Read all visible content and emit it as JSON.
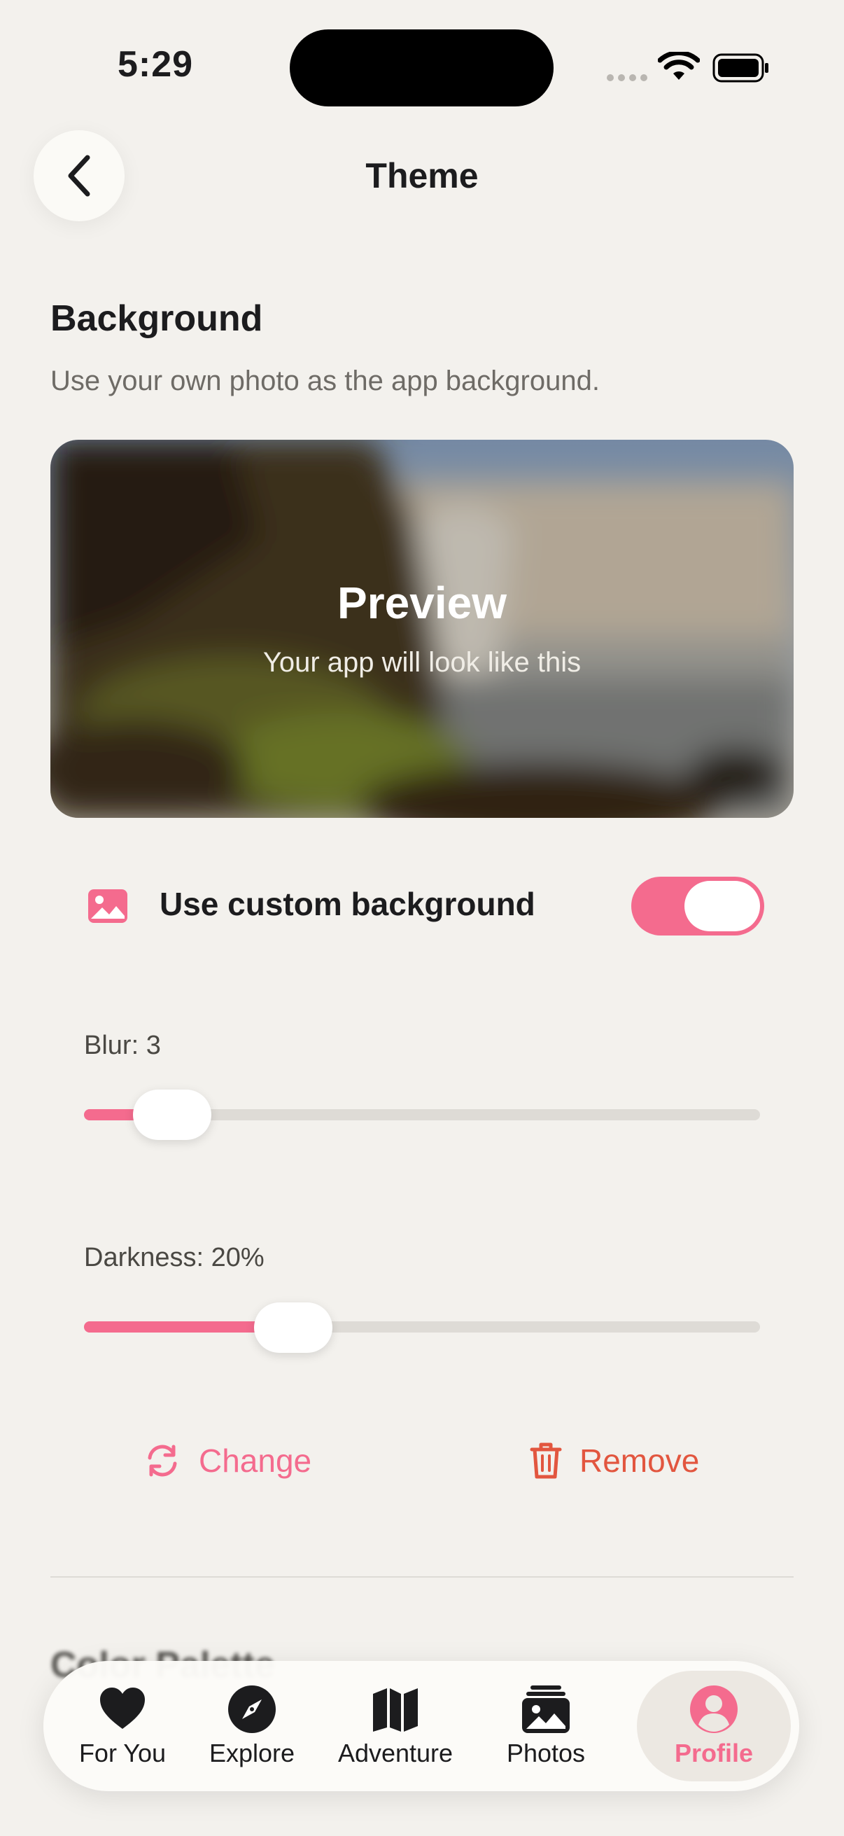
{
  "status_bar": {
    "time": "5:29"
  },
  "header": {
    "title": "Theme"
  },
  "background_section": {
    "title": "Background",
    "description": "Use your own photo as the app background."
  },
  "preview": {
    "title": "Preview",
    "subtitle": "Your app will look like this"
  },
  "custom_background": {
    "label": "Use custom background",
    "enabled": true
  },
  "blur_slider": {
    "label": "Blur: 3",
    "value": 3,
    "fill_fraction": 0.13
  },
  "darkness_slider": {
    "label": "Darkness: 20%",
    "value": 20,
    "fill_fraction": 0.31
  },
  "actions": {
    "change_label": "Change",
    "remove_label": "Remove"
  },
  "next_section": {
    "title": "Color Palette"
  },
  "tab_bar": {
    "tabs": [
      {
        "label": "For You",
        "icon": "heart-icon",
        "active": false
      },
      {
        "label": "Explore",
        "icon": "compass-icon",
        "active": false
      },
      {
        "label": "Adventure",
        "icon": "map-icon",
        "active": false
      },
      {
        "label": "Photos",
        "icon": "photos-icon",
        "active": false
      },
      {
        "label": "Profile",
        "icon": "profile-icon",
        "active": true
      }
    ]
  },
  "colors": {
    "accent": "#f46b8e",
    "destructive": "#e2563f",
    "background": "#f3f1ed"
  }
}
